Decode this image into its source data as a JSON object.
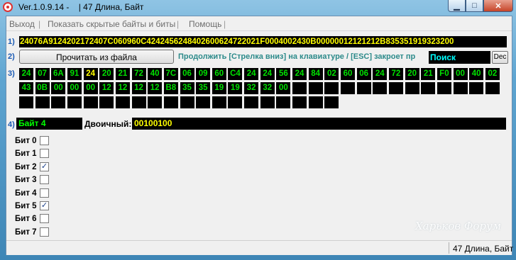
{
  "window": {
    "title": "Ver.1.0.9.14 -    | 47 Длина, Байт",
    "btn_minimize": "▁",
    "btn_maximize": "□",
    "btn_close": "✕"
  },
  "menu": {
    "exit": "Выход",
    "show_hidden": "Показать скрытые байты и биты",
    "help": "Помощь",
    "separator": "|"
  },
  "row_numbers": [
    "1)",
    "2)",
    "3)",
    "4)"
  ],
  "hex_string": "24076A9124202172407C060960C4242456248402600624722021F0004002430B00000012121212B835351919323200",
  "controls": {
    "read_button": "Прочитать из файла",
    "hint": "Продолжить [Стрелка вниз] на клавиатуре / [ESC] закроет пр",
    "search_value": "Поиск",
    "dec_button": "Dec"
  },
  "bytes": [
    "24",
    "07",
    "6A",
    "91",
    "24",
    "20",
    "21",
    "72",
    "40",
    "7C",
    "06",
    "09",
    "60",
    "C4",
    "24",
    "24",
    "56",
    "24",
    "84",
    "02",
    "60",
    "06",
    "24",
    "72",
    "20",
    "21",
    "F0",
    "00",
    "40",
    "02",
    "43",
    "0B",
    "00",
    "00",
    "00",
    "12",
    "12",
    "12",
    "12",
    "B8",
    "35",
    "35",
    "19",
    "19",
    "32",
    "32",
    "00"
  ],
  "selected_byte_index": 4,
  "byte_info": {
    "label": "Байт 4",
    "binary_label": "Двоичный:",
    "binary_value": "00100100"
  },
  "bits": [
    {
      "label": "Бит 0",
      "checked": false
    },
    {
      "label": "Бит 1",
      "checked": false
    },
    {
      "label": "Бит 2",
      "checked": true
    },
    {
      "label": "Бит 3",
      "checked": false
    },
    {
      "label": "Бит 4",
      "checked": false
    },
    {
      "label": "Бит 5",
      "checked": true
    },
    {
      "label": "Бит 6",
      "checked": false
    },
    {
      "label": "Бит 7",
      "checked": false
    }
  ],
  "watermark": "Харьков Форум",
  "status": "47 Длина, Байт"
}
